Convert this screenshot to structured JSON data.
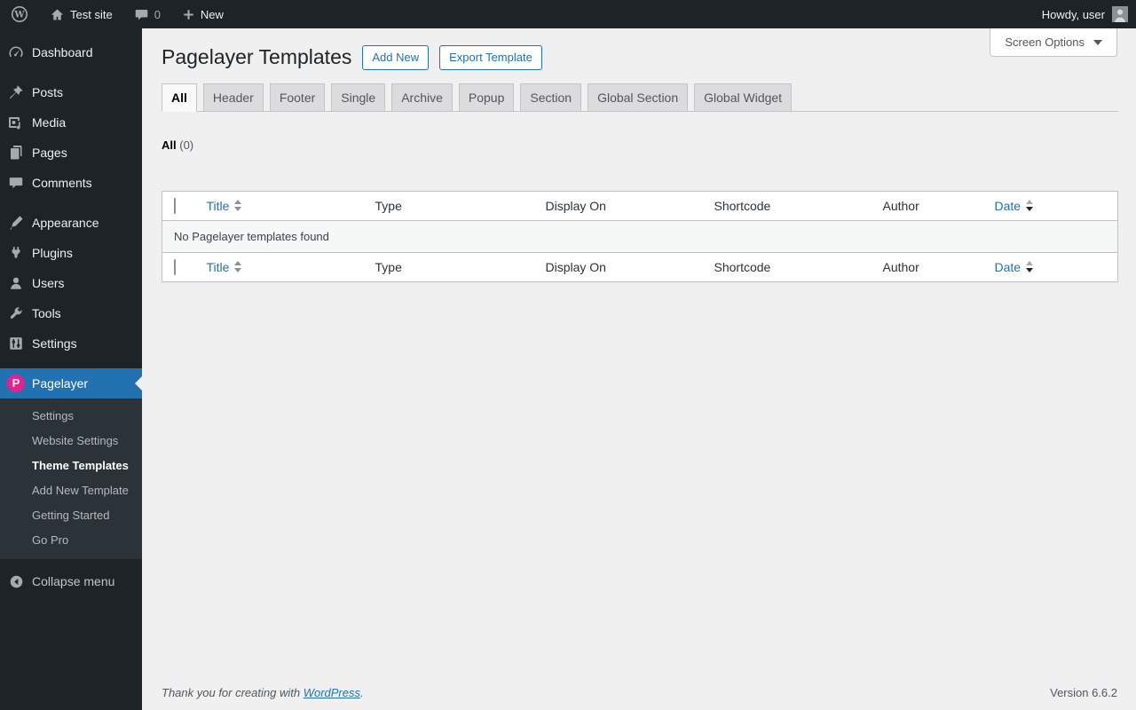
{
  "admin_bar": {
    "site_name": "Test site",
    "comments_count": "0",
    "new_label": "New",
    "howdy": "Howdy, user"
  },
  "sidebar": {
    "items": [
      {
        "label": "Dashboard",
        "icon": "dashboard-icon"
      },
      {
        "label": "Posts",
        "icon": "pin-icon"
      },
      {
        "label": "Media",
        "icon": "media-icon"
      },
      {
        "label": "Pages",
        "icon": "pages-icon"
      },
      {
        "label": "Comments",
        "icon": "comment-icon"
      },
      {
        "label": "Appearance",
        "icon": "brush-icon"
      },
      {
        "label": "Plugins",
        "icon": "plugin-icon"
      },
      {
        "label": "Users",
        "icon": "user-icon"
      },
      {
        "label": "Tools",
        "icon": "wrench-icon"
      },
      {
        "label": "Settings",
        "icon": "sliders-icon"
      },
      {
        "label": "Pagelayer",
        "icon": "pagelayer-icon"
      }
    ],
    "pagelayer_submenu": [
      {
        "label": "Settings",
        "current": false
      },
      {
        "label": "Website Settings",
        "current": false
      },
      {
        "label": "Theme Templates",
        "current": true
      },
      {
        "label": "Add New Template",
        "current": false
      },
      {
        "label": "Getting Started",
        "current": false
      },
      {
        "label": "Go Pro",
        "current": false
      }
    ],
    "collapse_label": "Collapse menu"
  },
  "header": {
    "title": "Pagelayer Templates",
    "add_new_label": "Add New",
    "export_label": "Export Template",
    "screen_options_label": "Screen Options"
  },
  "tabs": [
    "All",
    "Header",
    "Footer",
    "Single",
    "Archive",
    "Popup",
    "Section",
    "Global Section",
    "Global Widget"
  ],
  "active_tab": "All",
  "filter": {
    "all_label": "All",
    "count": "(0)"
  },
  "table": {
    "columns": [
      "Title",
      "Type",
      "Display On",
      "Shortcode",
      "Author",
      "Date"
    ],
    "sorted_column": "Date",
    "sort_direction": "desc",
    "empty_message": "No Pagelayer templates found"
  },
  "footer": {
    "thanks_prefix": "Thank you for creating with ",
    "wordpress_link": "WordPress",
    "thanks_suffix": ".",
    "version": "Version 6.6.2"
  },
  "colors": {
    "accent_blue": "#2271b1",
    "pagelayer_pink": "#ea1e8c",
    "adminbar_bg": "#1d2327",
    "submenu_bg": "#2c3338",
    "body_bg": "#f0f0f1",
    "border": "#c3c4c7"
  }
}
